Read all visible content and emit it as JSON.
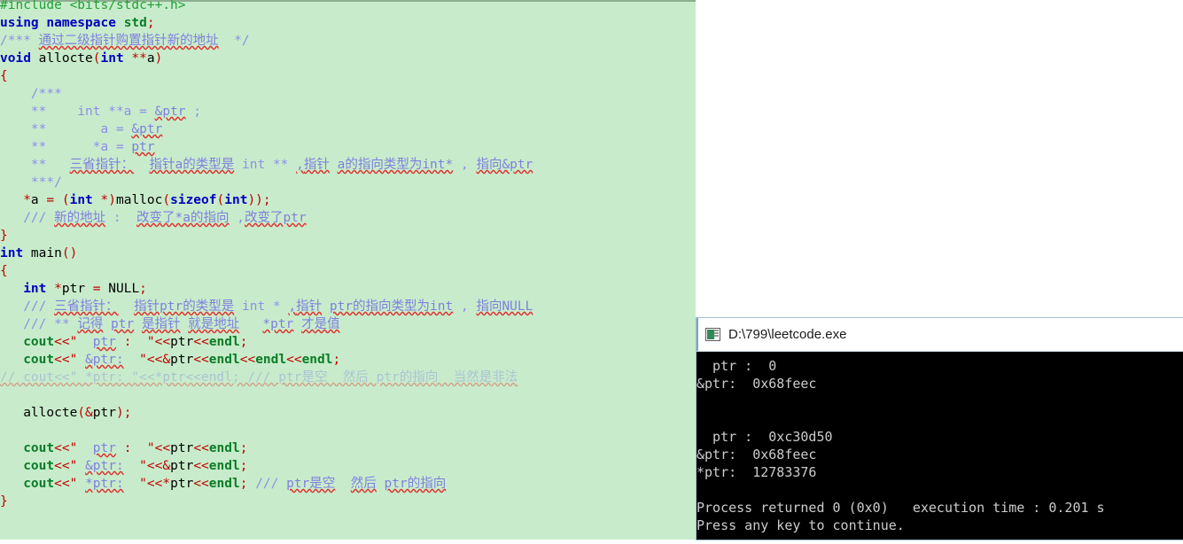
{
  "editor": {
    "language": "cpp",
    "background_color": "#c8eccb",
    "lines": [
      [
        {
          "t": "#include <bits/stdc++.h>",
          "c": "pre"
        }
      ],
      [
        {
          "t": "using namespace ",
          "c": "kw"
        },
        {
          "t": "std",
          "c": "str"
        },
        {
          "t": ";",
          "c": "op"
        }
      ],
      [
        {
          "t": "/*** ",
          "c": "cmt-plain"
        },
        {
          "t": "通过二级指针购置指针新的地址",
          "c": "cmt"
        },
        {
          "t": "  */",
          "c": "cmt-plain"
        }
      ],
      [
        {
          "t": "void ",
          "c": "kw"
        },
        {
          "t": "allocte",
          "c": "id"
        },
        {
          "t": "(",
          "c": "op"
        },
        {
          "t": "int ",
          "c": "kw"
        },
        {
          "t": "**",
          "c": "op"
        },
        {
          "t": "a",
          "c": "id"
        },
        {
          "t": ")",
          "c": "op"
        }
      ],
      [
        {
          "t": "{",
          "c": "op"
        }
      ],
      [
        {
          "t": "    /***",
          "c": "cmt-plain"
        }
      ],
      [
        {
          "t": "    **    int **a = ",
          "c": "cmt-plain"
        },
        {
          "t": "&ptr",
          "c": "cmt"
        },
        {
          "t": " ;",
          "c": "cmt-plain"
        }
      ],
      [
        {
          "t": "    **       a = ",
          "c": "cmt-plain"
        },
        {
          "t": "&ptr",
          "c": "cmt"
        }
      ],
      [
        {
          "t": "    **      *a = ",
          "c": "cmt-plain"
        },
        {
          "t": "ptr",
          "c": "cmt"
        }
      ],
      [
        {
          "t": "    **   ",
          "c": "cmt-plain"
        },
        {
          "t": "三省指针：",
          "c": "cmt"
        },
        {
          "t": "  ",
          "c": "cmt-plain"
        },
        {
          "t": "指针a的类型是",
          "c": "cmt"
        },
        {
          "t": " int ** ",
          "c": "cmt-plain"
        },
        {
          "t": ",",
          "c": "cmt"
        },
        {
          "t": "指针",
          "c": "cmt"
        },
        {
          "t": " ",
          "c": "cmt-plain"
        },
        {
          "t": "a的指向类型为int*",
          "c": "cmt"
        },
        {
          "t": " , ",
          "c": "cmt-plain"
        },
        {
          "t": "指向&ptr",
          "c": "cmt"
        }
      ],
      [
        {
          "t": "    ***/",
          "c": "cmt-plain"
        }
      ],
      [
        {
          "t": "   *",
          "c": "op"
        },
        {
          "t": "a ",
          "c": "id"
        },
        {
          "t": "= ",
          "c": "op"
        },
        {
          "t": "(",
          "c": "op"
        },
        {
          "t": "int ",
          "c": "kw"
        },
        {
          "t": "*",
          "c": "op"
        },
        {
          "t": ")",
          "c": "op"
        },
        {
          "t": "malloc",
          "c": "id"
        },
        {
          "t": "(",
          "c": "op"
        },
        {
          "t": "sizeof",
          "c": "kw"
        },
        {
          "t": "(",
          "c": "op"
        },
        {
          "t": "int",
          "c": "kw"
        },
        {
          "t": "))",
          "c": "op"
        },
        {
          "t": ";",
          "c": "op"
        }
      ],
      [
        {
          "t": "   /// ",
          "c": "cmt-plain"
        },
        {
          "t": "新的地址",
          "c": "cmt"
        },
        {
          "t": " : ",
          "c": "cmt-plain"
        },
        {
          "t": " ",
          "c": "cmt-plain"
        },
        {
          "t": "改变了*a的指向",
          "c": "cmt"
        },
        {
          "t": " ,",
          "c": "cmt-plain"
        },
        {
          "t": "改变了ptr",
          "c": "cmt"
        }
      ],
      [
        {
          "t": "}",
          "c": "op"
        }
      ],
      [
        {
          "t": "int ",
          "c": "kw"
        },
        {
          "t": "main",
          "c": "id"
        },
        {
          "t": "()",
          "c": "op"
        }
      ],
      [
        {
          "t": "{",
          "c": "op"
        }
      ],
      [
        {
          "t": "   ",
          "c": "blk"
        },
        {
          "t": "int ",
          "c": "kw"
        },
        {
          "t": "*",
          "c": "op"
        },
        {
          "t": "ptr ",
          "c": "id"
        },
        {
          "t": "= ",
          "c": "op"
        },
        {
          "t": "NULL",
          "c": "id"
        },
        {
          "t": ";",
          "c": "op"
        }
      ],
      [
        {
          "t": "   /// ",
          "c": "cmt-plain"
        },
        {
          "t": "三省指针：",
          "c": "cmt"
        },
        {
          "t": "  ",
          "c": "cmt-plain"
        },
        {
          "t": "指针ptr的类型是",
          "c": "cmt"
        },
        {
          "t": " int * ",
          "c": "cmt-plain"
        },
        {
          "t": ",",
          "c": "cmt"
        },
        {
          "t": "指针",
          "c": "cmt"
        },
        {
          "t": " ",
          "c": "cmt-plain"
        },
        {
          "t": "ptr的指向类型为int",
          "c": "cmt"
        },
        {
          "t": " , ",
          "c": "cmt-plain"
        },
        {
          "t": "指向NULL",
          "c": "cmt"
        }
      ],
      [
        {
          "t": "   /// ** ",
          "c": "cmt-plain"
        },
        {
          "t": "记得",
          "c": "cmt"
        },
        {
          "t": " ",
          "c": "cmt-plain"
        },
        {
          "t": "ptr",
          "c": "cmt"
        },
        {
          "t": " ",
          "c": "cmt-plain"
        },
        {
          "t": "是指针",
          "c": "cmt"
        },
        {
          "t": " ",
          "c": "cmt-plain"
        },
        {
          "t": "就是地址",
          "c": "cmt"
        },
        {
          "t": "   ",
          "c": "cmt-plain"
        },
        {
          "t": "*ptr",
          "c": "cmt"
        },
        {
          "t": " ",
          "c": "cmt-plain"
        },
        {
          "t": "才是值",
          "c": "cmt"
        }
      ],
      [
        {
          "t": "   ",
          "c": "blk"
        },
        {
          "t": "cout",
          "c": "str"
        },
        {
          "t": "<<",
          "c": "op"
        },
        {
          "t": "\"  ",
          "c": "strlit"
        },
        {
          "t": "ptr",
          "c": "cmt"
        },
        {
          "t": " : ",
          "c": "strlit"
        },
        {
          "t": " \"",
          "c": "strlit"
        },
        {
          "t": "<<",
          "c": "op"
        },
        {
          "t": "ptr",
          "c": "id"
        },
        {
          "t": "<<",
          "c": "op"
        },
        {
          "t": "endl",
          "c": "str"
        },
        {
          "t": ";",
          "c": "op"
        }
      ],
      [
        {
          "t": "   ",
          "c": "blk"
        },
        {
          "t": "cout",
          "c": "str"
        },
        {
          "t": "<<",
          "c": "op"
        },
        {
          "t": "\" ",
          "c": "strlit"
        },
        {
          "t": "&ptr:",
          "c": "cmt"
        },
        {
          "t": "  \"",
          "c": "strlit"
        },
        {
          "t": "<<",
          "c": "op"
        },
        {
          "t": "&",
          "c": "op"
        },
        {
          "t": "ptr",
          "c": "id"
        },
        {
          "t": "<<",
          "c": "op"
        },
        {
          "t": "endl",
          "c": "str"
        },
        {
          "t": "<<",
          "c": "op"
        },
        {
          "t": "endl",
          "c": "str"
        },
        {
          "t": "<<",
          "c": "op"
        },
        {
          "t": "endl",
          "c": "str"
        },
        {
          "t": ";",
          "c": "op"
        }
      ],
      [
        {
          "t": "// cout<<\" *ptr: \"<<*ptr<<endl; /// ptr是空  然后 ptr的指向  当然是非法",
          "c": "cmt faded"
        }
      ],
      [
        {
          "t": "",
          "c": "blk"
        }
      ],
      [
        {
          "t": "   ",
          "c": "blk"
        },
        {
          "t": "allocte",
          "c": "id"
        },
        {
          "t": "(",
          "c": "op"
        },
        {
          "t": "&",
          "c": "op"
        },
        {
          "t": "ptr",
          "c": "id"
        },
        {
          "t": ")",
          "c": "op"
        },
        {
          "t": ";",
          "c": "op"
        }
      ],
      [
        {
          "t": "",
          "c": "blk"
        }
      ],
      [
        {
          "t": "   ",
          "c": "blk"
        },
        {
          "t": "cout",
          "c": "str"
        },
        {
          "t": "<<",
          "c": "op"
        },
        {
          "t": "\"  ",
          "c": "strlit"
        },
        {
          "t": "ptr",
          "c": "cmt"
        },
        {
          "t": " : ",
          "c": "strlit"
        },
        {
          "t": " \"",
          "c": "strlit"
        },
        {
          "t": "<<",
          "c": "op"
        },
        {
          "t": "ptr",
          "c": "id"
        },
        {
          "t": "<<",
          "c": "op"
        },
        {
          "t": "endl",
          "c": "str"
        },
        {
          "t": ";",
          "c": "op"
        }
      ],
      [
        {
          "t": "   ",
          "c": "blk"
        },
        {
          "t": "cout",
          "c": "str"
        },
        {
          "t": "<<",
          "c": "op"
        },
        {
          "t": "\" ",
          "c": "strlit"
        },
        {
          "t": "&ptr:",
          "c": "cmt"
        },
        {
          "t": "  \"",
          "c": "strlit"
        },
        {
          "t": "<<",
          "c": "op"
        },
        {
          "t": "&",
          "c": "op"
        },
        {
          "t": "ptr",
          "c": "id"
        },
        {
          "t": "<<",
          "c": "op"
        },
        {
          "t": "endl",
          "c": "str"
        },
        {
          "t": ";",
          "c": "op"
        }
      ],
      [
        {
          "t": "   ",
          "c": "blk"
        },
        {
          "t": "cout",
          "c": "str"
        },
        {
          "t": "<<",
          "c": "op"
        },
        {
          "t": "\" ",
          "c": "strlit"
        },
        {
          "t": "*ptr:",
          "c": "cmt"
        },
        {
          "t": "  \"",
          "c": "strlit"
        },
        {
          "t": "<<",
          "c": "op"
        },
        {
          "t": "*",
          "c": "op"
        },
        {
          "t": "ptr",
          "c": "id"
        },
        {
          "t": "<<",
          "c": "op"
        },
        {
          "t": "endl",
          "c": "str"
        },
        {
          "t": "; ",
          "c": "op"
        },
        {
          "t": "/// ",
          "c": "cmt-plain"
        },
        {
          "t": "ptr是空",
          "c": "cmt"
        },
        {
          "t": "  ",
          "c": "cmt-plain"
        },
        {
          "t": "然后",
          "c": "cmt"
        },
        {
          "t": " ",
          "c": "cmt-plain"
        },
        {
          "t": "ptr的指向",
          "c": "cmt"
        }
      ],
      [
        {
          "t": "}",
          "c": "op"
        }
      ]
    ]
  },
  "console": {
    "title": "D:\\799\\leetcode.exe",
    "icon": "console-app-icon",
    "output_lines": [
      "  ptr :  0",
      "&ptr:  0x68feec",
      "",
      "",
      "  ptr :  0xc30d50",
      "&ptr:  0x68feec",
      "*ptr:  12783376",
      "",
      "Process returned 0 (0x0)   execution time : 0.201 s",
      "Press any key to continue."
    ]
  }
}
